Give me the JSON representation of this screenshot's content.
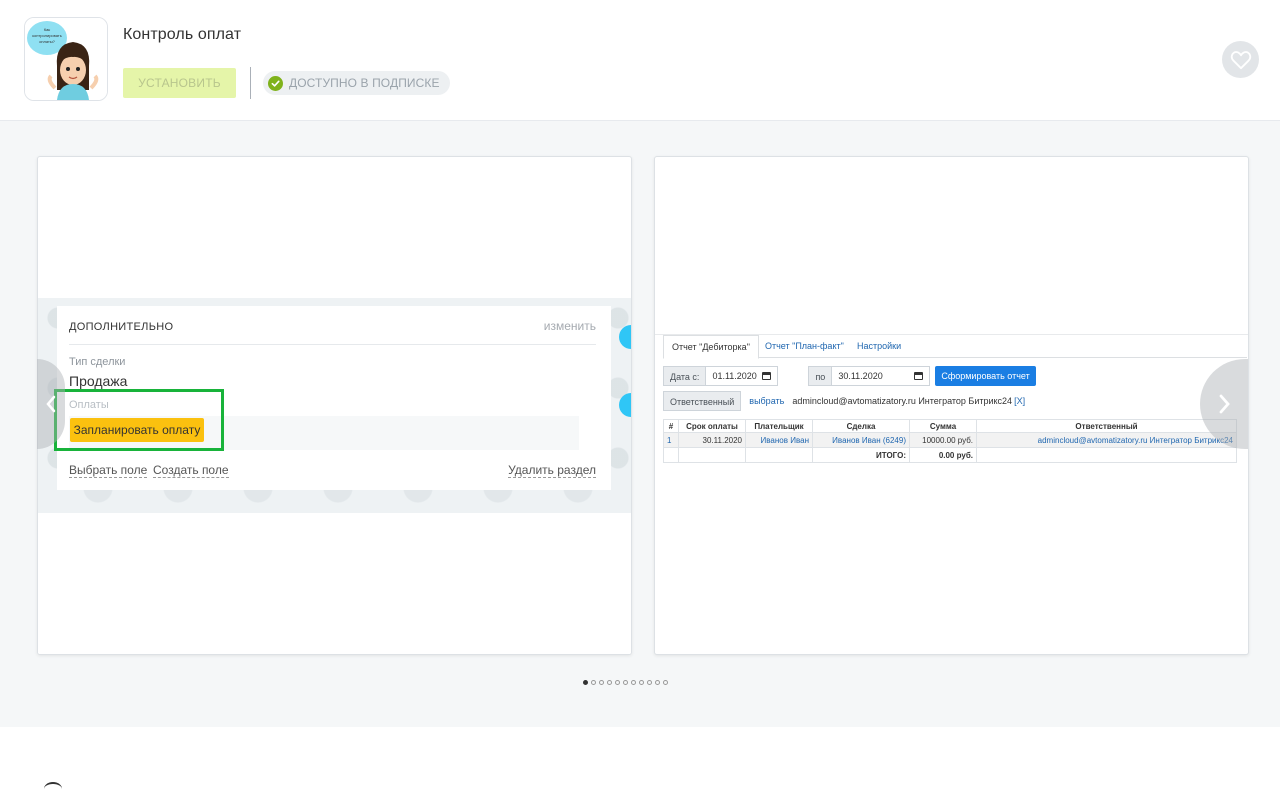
{
  "app": {
    "title": "Контроль оплат",
    "icon_text": "Как контролировать оплаты?",
    "install_label": "Установить",
    "subscription_label": "Доступно в подписке"
  },
  "icons": {
    "favorite": "heart-icon",
    "check": "check-icon",
    "next": "chevron-right-icon",
    "prev": "chevron-left-icon"
  },
  "colors": {
    "install_bg": "#e5f5a9",
    "check_green": "#7fb21b",
    "schedule_button": "#fbc10f",
    "highlight": "#18b33a",
    "generate_button": "#1a7ee3"
  },
  "slide1": {
    "section_title": "Дополнительно",
    "change_label": "изменить",
    "deal_type_label": "Тип сделки",
    "deal_type_value": "Продажа",
    "payments_label": "Оплаты",
    "schedule_button": "Запланировать оплату",
    "select_field": "Выбрать поле",
    "create_field": "Создать поле",
    "delete_section": "Удалить раздел"
  },
  "slide2": {
    "tabs": [
      "Отчет \"Дебиторка\"",
      "Отчет \"План-факт\"",
      "Настройки"
    ],
    "date_from_label": "Дата с:",
    "date_from": "01.11.2020",
    "date_to_label": "по",
    "date_to": "30.11.2020",
    "generate_button": "Сформировать отчет",
    "responsible_label": "Ответственный",
    "choose_link": "выбрать",
    "responsible_value": "admincloud@avtomatizatory.ru Интегратор Битрикс24",
    "remove_link": "[X]",
    "table": {
      "headers": [
        "#",
        "Срок оплаты",
        "Плательщик",
        "Сделка",
        "Сумма",
        "Ответственный"
      ],
      "rows": [
        [
          "1",
          "30.11.2020",
          "Иванов Иван",
          "Иванов Иван (6249)",
          "10000.00 руб.",
          "admincloud@avtomatizatory.ru Интегратор Битрикс24"
        ]
      ],
      "total_label": "ИТОГО:",
      "total_value": "0.00 руб."
    }
  },
  "pager": {
    "count": 11,
    "active": 0
  }
}
